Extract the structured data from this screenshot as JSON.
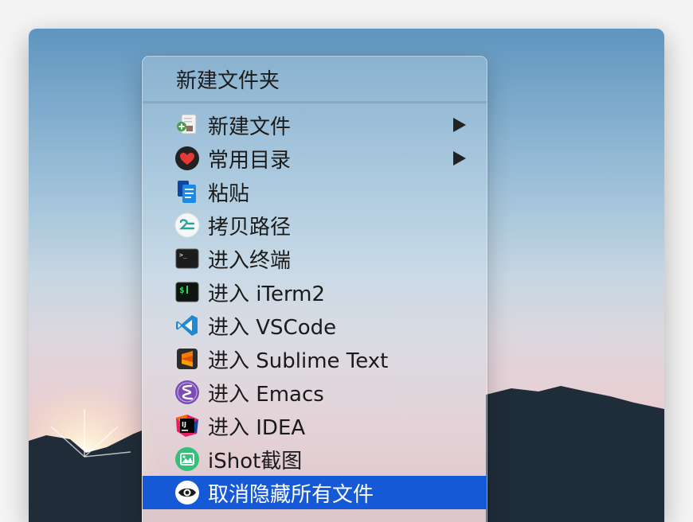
{
  "menu": {
    "title": "新建文件夹",
    "items": [
      {
        "label": "新建文件",
        "submenu": true
      },
      {
        "label": "常用目录",
        "submenu": true
      },
      {
        "label": "粘贴"
      },
      {
        "label": "拷贝路径"
      },
      {
        "label": "进入终端"
      },
      {
        "label": "进入 iTerm2"
      },
      {
        "label": "进入 VSCode"
      },
      {
        "label": "进入 Sublime Text"
      },
      {
        "label": "进入 Emacs"
      },
      {
        "label": "进入 IDEA"
      },
      {
        "label": "iShot截图"
      },
      {
        "label": "取消隐藏所有文件",
        "highlighted": true
      }
    ]
  },
  "icons": {
    "term_glyph": ">_",
    "iterm_glyph": "$",
    "idea_glyph": "IJ"
  },
  "colors": {
    "highlight": "#1659d6",
    "heart": "#e53935",
    "paste": "#1e88e5",
    "vscode": "#1f8ad2",
    "sublime": "#f57c00",
    "emacs": "#7b4cb4",
    "ishot": "#35c07a"
  }
}
